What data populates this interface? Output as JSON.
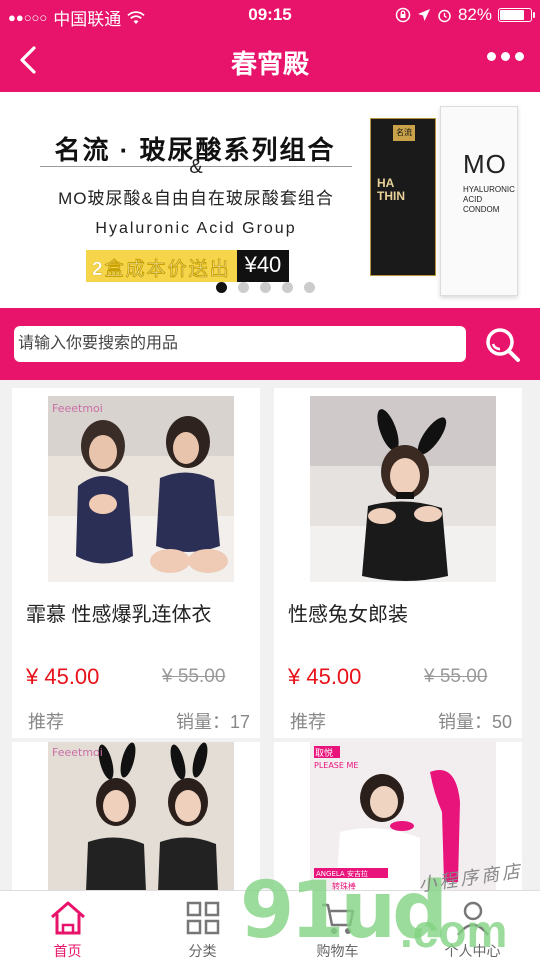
{
  "status_bar": {
    "signal": "●●○○○",
    "carrier": "中国联通",
    "time": "09:15",
    "battery": "82%",
    "battery_level": 0.82
  },
  "nav": {
    "title": "春宵殿"
  },
  "banner": {
    "title": "名流 · 玻尿酸系列组合",
    "ampersand": "&",
    "subtitle": "MO玻尿酸&自由自在玻尿酸套组合",
    "english": "Hyaluronic Acid Group",
    "promo": "2盒成本价送出",
    "price": "¥40",
    "box_black": {
      "logo": "名流",
      "name_line1": "HA",
      "name_line2": "THIN"
    },
    "box_white": {
      "brand": "MO",
      "desc_line1": "HYALURONIC",
      "desc_line2": "ACID",
      "desc_line3": "CONDOM"
    },
    "active_dot": 0,
    "dot_count": 5
  },
  "search": {
    "placeholder": "请输入你要搜索的用品"
  },
  "products": [
    {
      "name": "霏慕 性感爆乳连体衣",
      "price": "¥ 45.00",
      "old_price": "¥ 55.00",
      "tag": "推荐",
      "sales": "销量：17",
      "image_brand": "Feeetmoi"
    },
    {
      "name": "性感兔女郎装",
      "price": "¥ 45.00",
      "old_price": "¥ 55.00",
      "tag": "推荐",
      "sales": "销量：50",
      "image_brand": ""
    },
    {
      "name": "",
      "price": "",
      "old_price": "",
      "tag": "",
      "sales": "",
      "image_brand": "Feeetmoi"
    },
    {
      "name": "",
      "price": "",
      "old_price": "",
      "tag": "",
      "sales": "",
      "image_brand": "取悦",
      "image_brand_en": "PLEASE ME",
      "image_tag": "ANGELA  安吉拉",
      "image_tag2": "转珠棒"
    }
  ],
  "tabbar": [
    {
      "label": "首页",
      "icon": "home-icon",
      "active": true
    },
    {
      "label": "分类",
      "icon": "grid-icon",
      "active": false
    },
    {
      "label": "购物车",
      "icon": "cart-icon",
      "active": false
    },
    {
      "label": "个人中心",
      "icon": "user-icon",
      "active": false
    }
  ],
  "watermark": {
    "big": "91ud",
    "com": ".com",
    "script": "小程序商店"
  },
  "colors": {
    "brand": "#e8136a",
    "price": "#e8131a",
    "banner_yellow": "#f7d54a"
  }
}
